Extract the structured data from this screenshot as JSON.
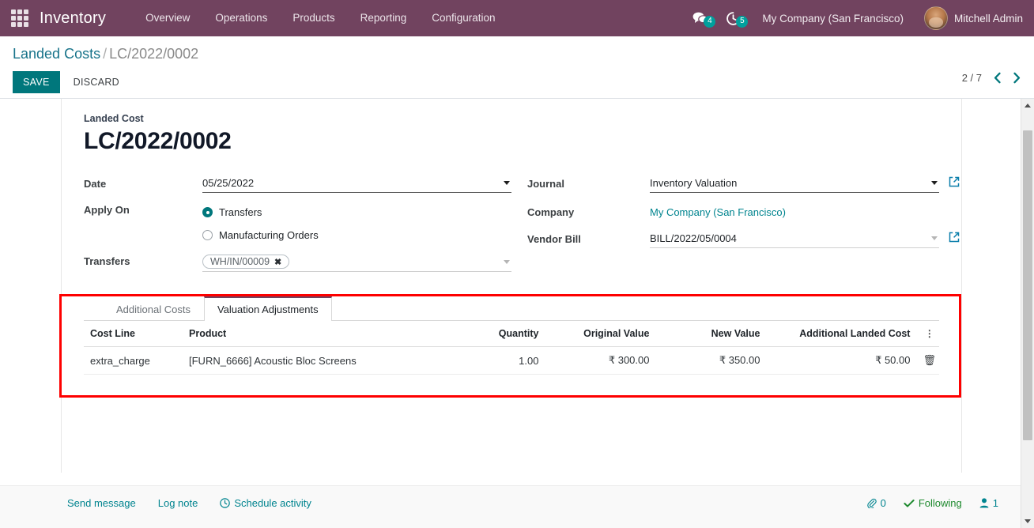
{
  "navbar": {
    "apps_icon": "apps-grid-icon",
    "brand": "Inventory",
    "menu": [
      {
        "label": "Overview"
      },
      {
        "label": "Operations"
      },
      {
        "label": "Products"
      },
      {
        "label": "Reporting"
      },
      {
        "label": "Configuration"
      }
    ],
    "messages_icon": "messages-icon",
    "messages_count": "4",
    "activities_icon": "clock-icon",
    "activities_count": "5",
    "company": "My Company (San Francisco)",
    "user": "Mitchell Admin",
    "bg_color": "#71435f",
    "badge_color": "#00a09d"
  },
  "control_panel": {
    "breadcrumb_root": "Landed Costs",
    "breadcrumb_sep": "/",
    "breadcrumb_current": "LC/2022/0002",
    "save_label": "SAVE",
    "discard_label": "DISCARD",
    "pager": "2 / 7",
    "prev_icon": "chevron-left-icon",
    "next_icon": "chevron-right-icon"
  },
  "form": {
    "title_label": "Landed Cost",
    "title_value": "LC/2022/0002",
    "left_fields": {
      "date_label": "Date",
      "date_value": "05/25/2022",
      "apply_on_label": "Apply On",
      "apply_on_options": [
        {
          "label": "Transfers",
          "selected": true
        },
        {
          "label": "Manufacturing Orders",
          "selected": false
        }
      ],
      "transfers_label": "Transfers",
      "transfers_tag": "WH/IN/00009",
      "transfers_tag_remove": "remove-tag-icon"
    },
    "right_fields": {
      "journal_label": "Journal",
      "journal_value": "Inventory Valuation",
      "journal_external": "external-link-icon",
      "company_label": "Company",
      "company_value": "My Company (San Francisco)",
      "vendor_bill_label": "Vendor Bill",
      "vendor_bill_value": "BILL/2022/05/0004",
      "vendor_bill_external": "external-link-icon"
    }
  },
  "notebook": {
    "tabs": [
      {
        "label": "Additional Costs",
        "active": false
      },
      {
        "label": "Valuation Adjustments",
        "active": true
      }
    ],
    "table": {
      "columns": [
        "Cost Line",
        "Product",
        "Quantity",
        "Original Value",
        "New Value",
        "Additional Landed Cost"
      ],
      "optional_columns_icon": "vertical-dots-icon",
      "rows": [
        {
          "cost_line": "extra_charge",
          "product": "[FURN_6666] Acoustic Bloc Screens",
          "quantity": "1.00",
          "original_value": "₹ 300.00",
          "new_value": "₹ 350.00",
          "additional_landed_cost": "₹ 50.00",
          "delete_icon": "trash-icon",
          "row_menu": "..."
        }
      ]
    },
    "highlight_color": "#fe0000"
  },
  "chatter": {
    "send_message": "Send message",
    "log_note": "Log note",
    "schedule_activity": "Schedule activity",
    "schedule_icon": "clock-icon",
    "attachment_icon": "paperclip-icon",
    "attachment_count": "0",
    "following_icon": "check-icon",
    "following_label": "Following",
    "followers_icon": "user-icon",
    "followers_count": "1"
  },
  "scrollbar": {
    "up_icon": "triangle-up-icon",
    "down_icon": "triangle-down-icon"
  }
}
